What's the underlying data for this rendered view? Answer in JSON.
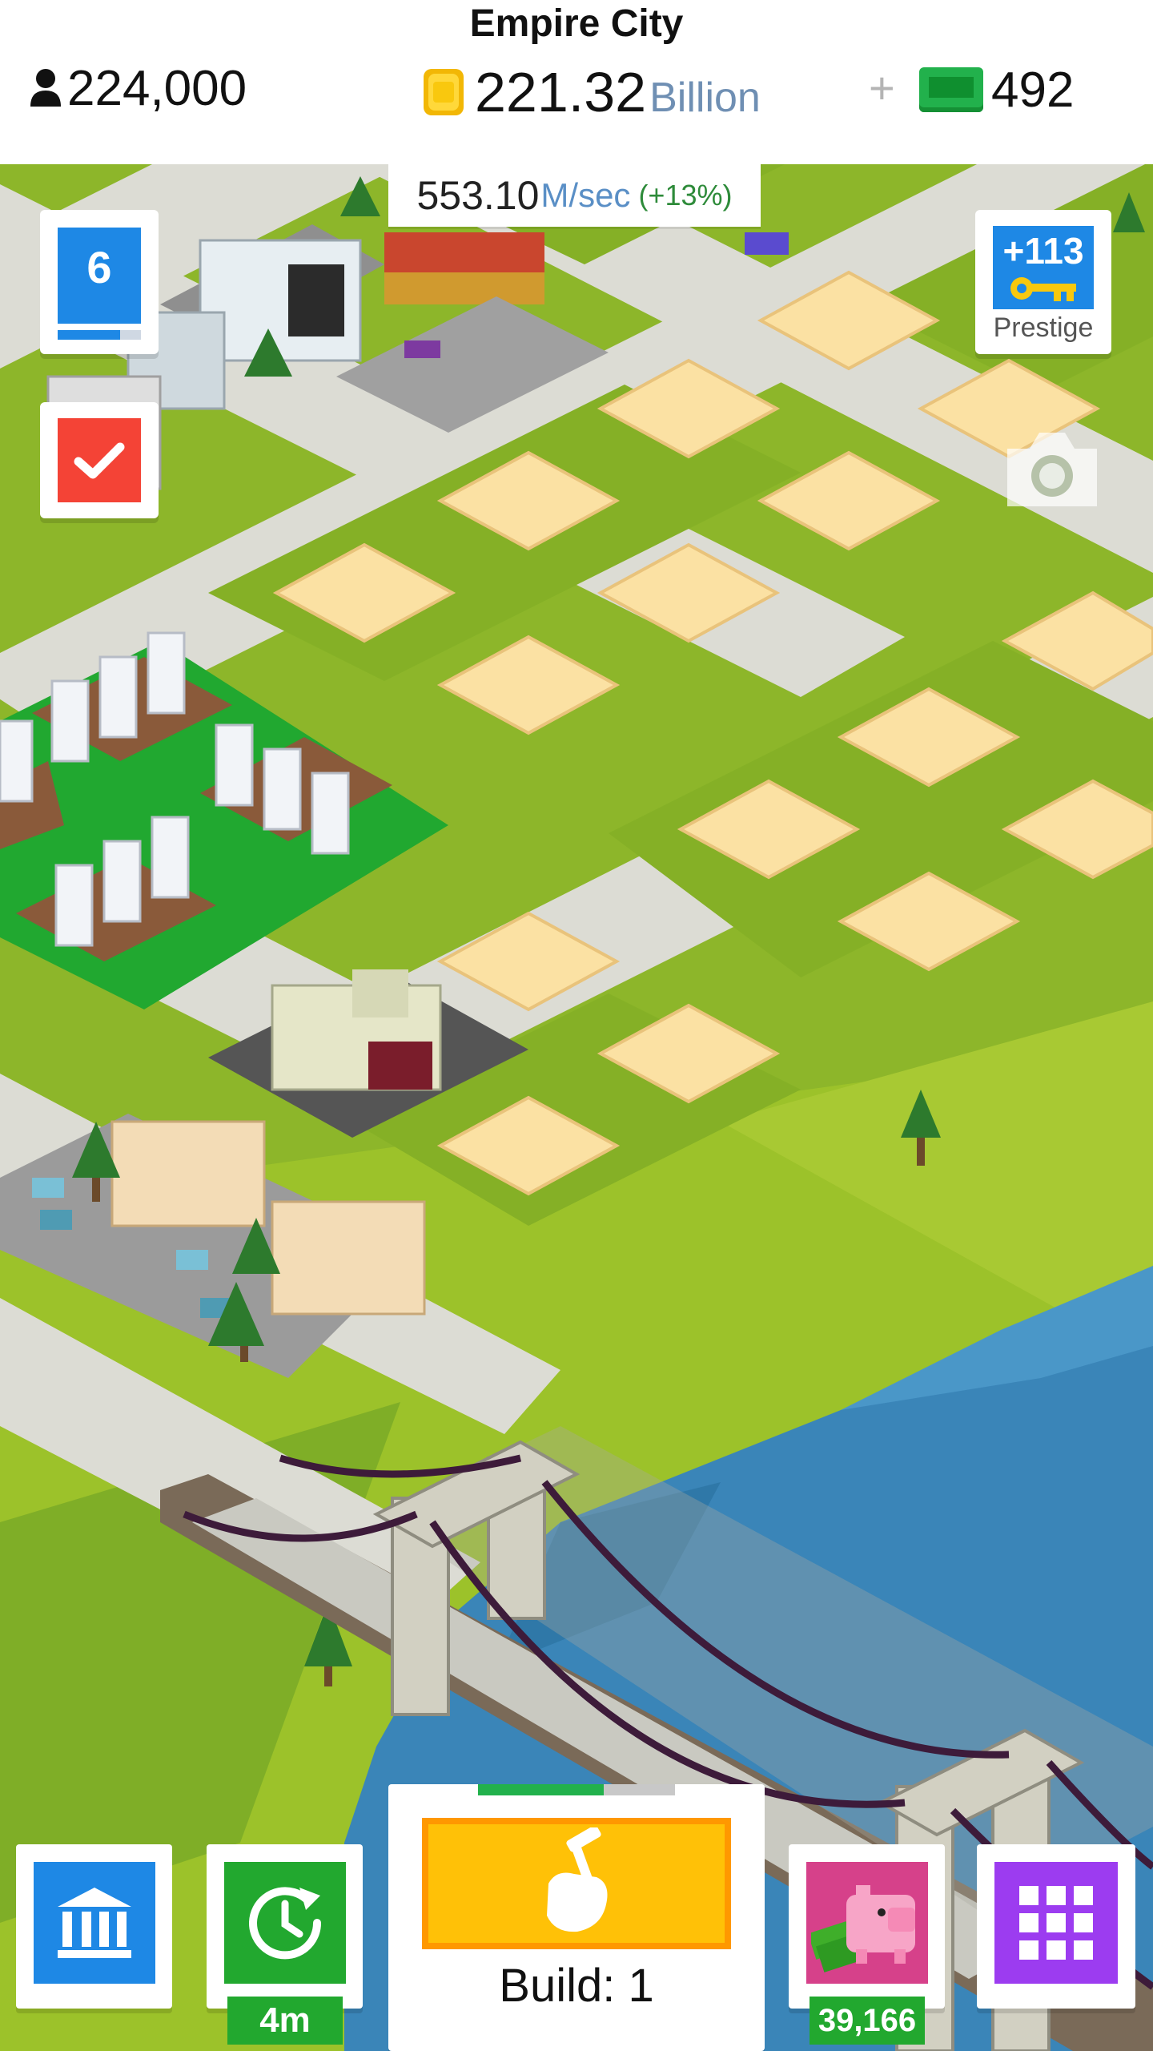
{
  "header": {
    "city_name": "Empire City",
    "population": "224,000",
    "money_amount": "221.32",
    "money_unit": "Billion",
    "plus_symbol": "+",
    "gems": "492"
  },
  "income": {
    "value": "553.10",
    "unit": "M/sec",
    "bonus": "(+13%)"
  },
  "level": {
    "number": "6",
    "progress_fraction": 0.75
  },
  "prestige": {
    "count": "+113",
    "label": "Prestige"
  },
  "bottom_bar": {
    "boost_timer": "4m",
    "build_label": "Build: 1",
    "build_progress_fraction": 0.64,
    "piggy_value": "39,166"
  },
  "icons": {
    "population": "person-icon",
    "money": "coin-icon",
    "gems": "cash-icon",
    "tasks": "checkmark-icon",
    "prestige": "key-icon",
    "screenshot": "camera-icon",
    "museum": "museum-icon",
    "boost": "clock-icon",
    "build": "hammer-hand-icon",
    "bank": "piggy-bank-icon",
    "menu": "grid-icon"
  },
  "colors": {
    "accent_blue": "#1e88e5",
    "task_red": "#f44336",
    "boost_green": "#22a82f",
    "build_yellow": "#ffc107",
    "piggy_pink": "#d6418a",
    "menu_purple": "#9c3cf0"
  }
}
